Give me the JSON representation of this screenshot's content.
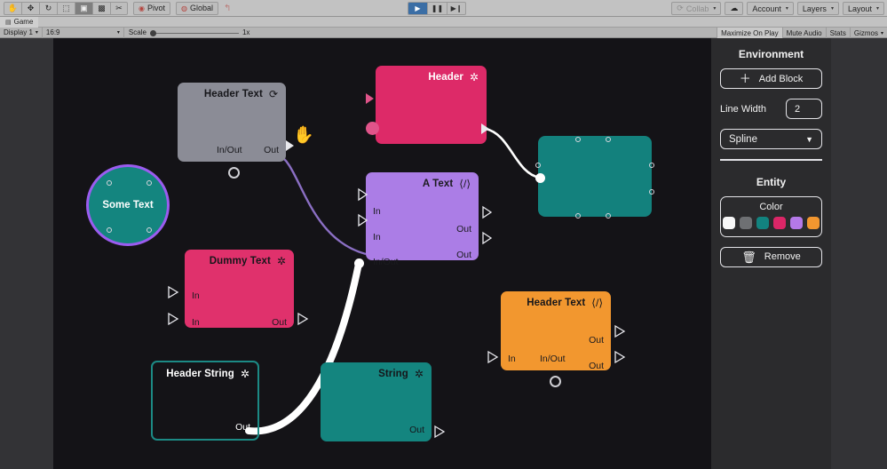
{
  "toolbar": {
    "tools": [
      {
        "name": "hand-tool",
        "glyph": "✋",
        "active": false
      },
      {
        "name": "move-tool",
        "glyph": "✥",
        "active": false
      },
      {
        "name": "rotate-tool",
        "glyph": "↻",
        "active": false
      },
      {
        "name": "scale-tool",
        "glyph": "⬚",
        "active": false
      },
      {
        "name": "rect-tool",
        "glyph": "▣",
        "active": true
      },
      {
        "name": "transform-tool",
        "glyph": "▩",
        "active": false
      },
      {
        "name": "custom-tool",
        "glyph": "✂",
        "active": false
      }
    ],
    "pivot_label": "Pivot",
    "global_label": "Global",
    "play_label": "▶",
    "pause_label": "❚❚",
    "step_label": "▶❙",
    "collab_label": "Collab",
    "cloud_label": "☁",
    "account_label": "Account",
    "layers_label": "Layers",
    "layout_label": "Layout"
  },
  "tab": {
    "icon": "game-view-icon",
    "label": "Game"
  },
  "gamebar": {
    "display_label": "Display 1",
    "aspect_label": "16:9",
    "scale_label": "Scale",
    "scale_value": "1x",
    "maximize_label": "Maximize On Play",
    "mute_label": "Mute Audio",
    "stats_label": "Stats",
    "gizmos_label": "Gizmos"
  },
  "panel": {
    "environment_title": "Environment",
    "add_block_label": "Add Block",
    "add_block_icon": "plus-icon",
    "line_width_label": "Line Width",
    "line_width_value": "2",
    "curve_type_value": "Spline",
    "entity_title": "Entity",
    "color_label": "Color",
    "colors": [
      "#f7f7f7",
      "#6e7073",
      "#12837f",
      "#db2667",
      "#b479e8",
      "#f2962f"
    ],
    "remove_label": "Remove",
    "remove_icon": "trash-icon"
  },
  "nodes": [
    {
      "id": "header-text-gray",
      "title": "Header Text",
      "icon": "refresh-icon",
      "icon_glyph": "⟳",
      "color": "#8b8c96",
      "text_color": "#1b1b1f",
      "ports": {
        "bottom_center": "In/Out",
        "bottom_right": "Out"
      }
    },
    {
      "id": "header-pink",
      "title": "Header",
      "icon": "gear-icon",
      "icon_glyph": "✲",
      "color": "#dd2a68",
      "text_color": "#ffffff",
      "ports": {}
    },
    {
      "id": "a-text-purple",
      "title": "A Text",
      "icon": "code-icon",
      "icon_glyph": "⟨/⟩",
      "color": "#ab7de6",
      "text_color": "#1b1b1f",
      "ports": {
        "in_1": "In",
        "in_2": "In",
        "in_out": "In/Out",
        "out_1": "Out",
        "out_2": "Out"
      }
    },
    {
      "id": "some-text-circle",
      "title": "Some Text",
      "icon": "none",
      "icon_glyph": "",
      "color": "#14857f",
      "text_color": "#ffffff",
      "ports": {}
    },
    {
      "id": "dummy-text-pink",
      "title": "Dummy Text",
      "icon": "gear-icon",
      "icon_glyph": "✲",
      "color": "#e0316c",
      "text_color": "#1b1b1f",
      "ports": {
        "in_1": "In",
        "in_2": "In",
        "out_1": "Out"
      }
    },
    {
      "id": "header-string-outline",
      "title": "Header String",
      "icon": "gear-icon",
      "icon_glyph": "✲",
      "color": "transparent",
      "text_color": "#ffffff",
      "ports": {
        "out_1": "Out"
      }
    },
    {
      "id": "string-teal",
      "title": "String",
      "icon": "gear-icon",
      "icon_glyph": "✲",
      "color": "#14857f",
      "text_color": "#1b1b1f",
      "ports": {
        "out_1": "Out"
      }
    },
    {
      "id": "header-text-orange",
      "title": "Header Text",
      "icon": "code-icon",
      "icon_glyph": "⟨/⟩",
      "color": "#f2972f",
      "text_color": "#1b1b1f",
      "ports": {
        "in_1": "In",
        "in_out": "In/Out",
        "out_1": "Out",
        "out_2": "Out"
      }
    },
    {
      "id": "teal-rect-shape",
      "title": "",
      "icon": "none",
      "icon_glyph": "",
      "color": "#13817d",
      "text_color": "#ffffff",
      "ports": {}
    }
  ],
  "cursor": {
    "name": "hand-cursor",
    "glyph": "✋"
  }
}
